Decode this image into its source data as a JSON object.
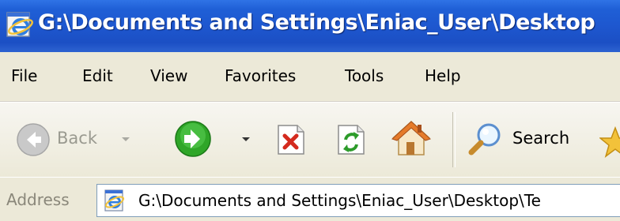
{
  "window": {
    "title": "G:\\Documents and Settings\\Eniac_User\\Desktop"
  },
  "menu": {
    "items": [
      "File",
      "Edit",
      "View",
      "Favorites",
      "Tools",
      "Help"
    ]
  },
  "toolbar": {
    "back_label": "Back",
    "search_label": "Search",
    "back_state": "disabled",
    "icons": [
      "back-icon",
      "forward-icon",
      "stop-icon",
      "refresh-icon",
      "home-icon",
      "search-icon",
      "favorites-icon"
    ]
  },
  "address": {
    "label": "Address",
    "value": "G:\\Documents and Settings\\Eniac_User\\Desktop\\Te"
  },
  "colors": {
    "titlebar": "#1f5fd6",
    "chrome": "#ece9d8",
    "forward_green": "#2fa628",
    "stop_red": "#d42a1e",
    "address_border": "#7f9db9"
  }
}
